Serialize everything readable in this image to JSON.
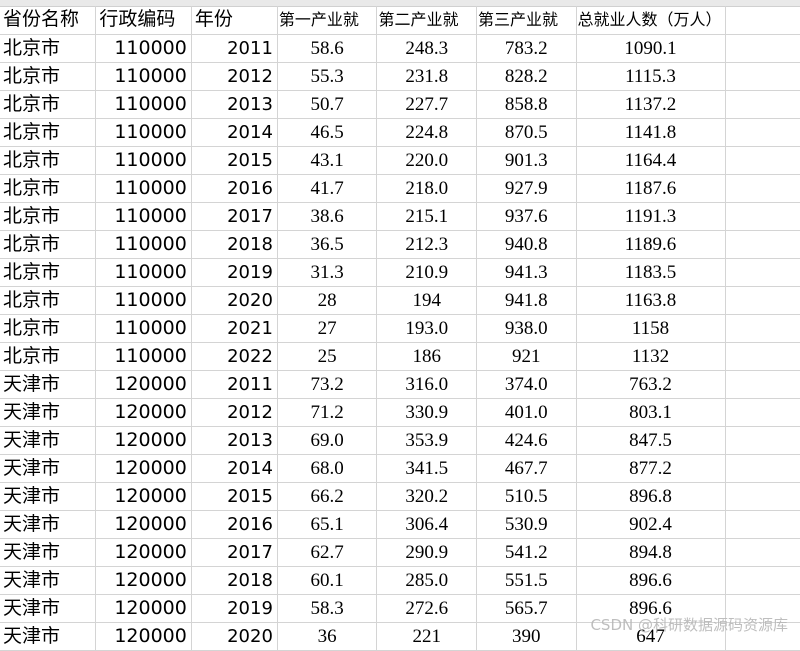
{
  "headers": [
    "省份名称",
    "行政编码",
    "年份",
    "第一产业就",
    "第二产业就",
    "第三产业就",
    "总就业人数（万人）"
  ],
  "rows": [
    [
      "北京市",
      "110000",
      "2011",
      "58.6",
      "248.3",
      "783.2",
      "1090.1"
    ],
    [
      "北京市",
      "110000",
      "2012",
      "55.3",
      "231.8",
      "828.2",
      "1115.3"
    ],
    [
      "北京市",
      "110000",
      "2013",
      "50.7",
      "227.7",
      "858.8",
      "1137.2"
    ],
    [
      "北京市",
      "110000",
      "2014",
      "46.5",
      "224.8",
      "870.5",
      "1141.8"
    ],
    [
      "北京市",
      "110000",
      "2015",
      "43.1",
      "220.0",
      "901.3",
      "1164.4"
    ],
    [
      "北京市",
      "110000",
      "2016",
      "41.7",
      "218.0",
      "927.9",
      "1187.6"
    ],
    [
      "北京市",
      "110000",
      "2017",
      "38.6",
      "215.1",
      "937.6",
      "1191.3"
    ],
    [
      "北京市",
      "110000",
      "2018",
      "36.5",
      "212.3",
      "940.8",
      "1189.6"
    ],
    [
      "北京市",
      "110000",
      "2019",
      "31.3",
      "210.9",
      "941.3",
      "1183.5"
    ],
    [
      "北京市",
      "110000",
      "2020",
      "28",
      "194",
      "941.8",
      "1163.8"
    ],
    [
      "北京市",
      "110000",
      "2021",
      "27",
      "193.0",
      "938.0",
      "1158"
    ],
    [
      "北京市",
      "110000",
      "2022",
      "25",
      "186",
      "921",
      "1132"
    ],
    [
      "天津市",
      "120000",
      "2011",
      "73.2",
      "316.0",
      "374.0",
      "763.2"
    ],
    [
      "天津市",
      "120000",
      "2012",
      "71.2",
      "330.9",
      "401.0",
      "803.1"
    ],
    [
      "天津市",
      "120000",
      "2013",
      "69.0",
      "353.9",
      "424.6",
      "847.5"
    ],
    [
      "天津市",
      "120000",
      "2014",
      "68.0",
      "341.5",
      "467.7",
      "877.2"
    ],
    [
      "天津市",
      "120000",
      "2015",
      "66.2",
      "320.2",
      "510.5",
      "896.8"
    ],
    [
      "天津市",
      "120000",
      "2016",
      "65.1",
      "306.4",
      "530.9",
      "902.4"
    ],
    [
      "天津市",
      "120000",
      "2017",
      "62.7",
      "290.9",
      "541.2",
      "894.8"
    ],
    [
      "天津市",
      "120000",
      "2018",
      "60.1",
      "285.0",
      "551.5",
      "896.6"
    ],
    [
      "天津市",
      "120000",
      "2019",
      "58.3",
      "272.6",
      "565.7",
      "896.6"
    ],
    [
      "天津市",
      "120000",
      "2020",
      "36",
      "221",
      "390",
      "647"
    ]
  ],
  "watermark": "CSDN @科研数据源码资源库"
}
